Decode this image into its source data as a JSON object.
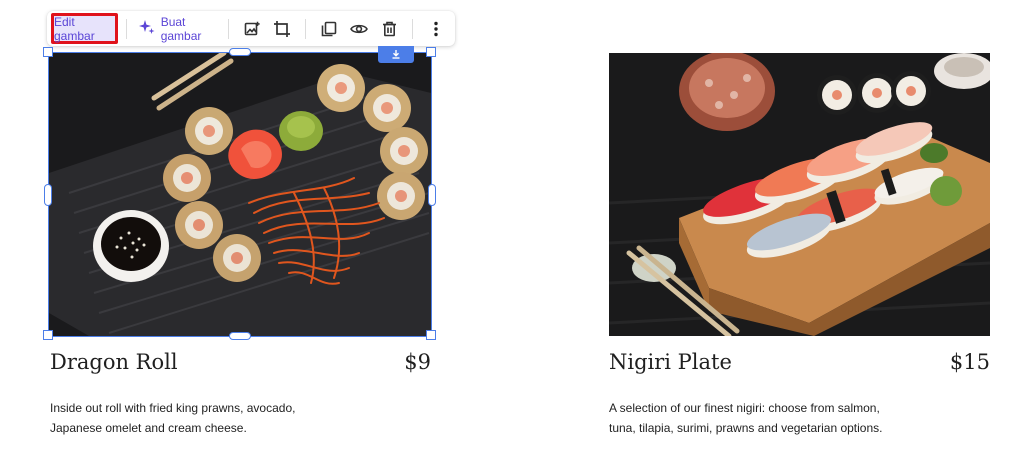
{
  "toolbar": {
    "edit_label": "Edit gambar",
    "create_label": "Buat gambar",
    "icons": [
      "sparkle-icon",
      "image-adjust-icon",
      "crop-icon",
      "duplicate-icon",
      "eye-icon",
      "trash-icon",
      "more-vertical-icon"
    ]
  },
  "menu_items": [
    {
      "title": "Dragon Roll",
      "price": "$9",
      "description_line1": "Inside out roll with fried king prawns, avocado,",
      "description_line2": "Japanese omelet and cream cheese."
    },
    {
      "title": "Nigiri Plate",
      "price": "$15",
      "description_line1": "A selection of our finest nigiri: choose from salmon,",
      "description_line2": "tuna, tilapia, surimi, prawns and vegetarian options."
    }
  ],
  "colors": {
    "accent": "#5b45d6",
    "selection": "#4c7ee8",
    "highlight": "#e0121b"
  }
}
